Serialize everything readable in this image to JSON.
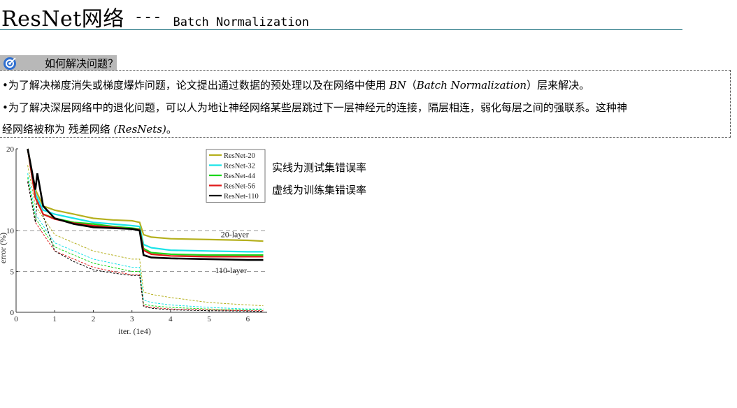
{
  "header": {
    "title": "ResNet网络",
    "dashes": "---",
    "subtitle": "Batch Normalization"
  },
  "question": {
    "icon": "target-icon",
    "text": "如何解决问题？"
  },
  "bullets": [
    {
      "prefix": "•为了解决梯度消失或梯度爆炸问题，论文提出通过数据的预处理以及在网络中使用 ",
      "term": "BN",
      "mid": "（",
      "term2": "Batch Normalization",
      "suffix": "）层来解决。"
    },
    {
      "text1": "•为了解决深层网络中的退化问题，可以人为地让神经网络某些层跳过下一层神经元的连接，隔层相连，弱化每层之间的强联系。这种神",
      "text2a": "经网络被称为 残差网络 ",
      "term": "(ResNets)",
      "text2b": "。"
    }
  ],
  "notes": [
    "实线为测试集错误率",
    "虚线为训练集错误率"
  ],
  "colors": {
    "accent_rule": "#2f7d89",
    "question_bar": "#b8b8b8"
  },
  "chart_data": {
    "type": "line",
    "xlabel": "iter. (1e4)",
    "ylabel": "error (%)",
    "xlim": [
      0,
      6.5
    ],
    "ylim": [
      0,
      20
    ],
    "xticks": [
      "0",
      "1",
      "2",
      "3",
      "4",
      "5",
      "6"
    ],
    "yticks": [
      "0",
      "5",
      "10",
      "20"
    ],
    "annotations": [
      "20-layer",
      "110-layer"
    ],
    "legend_position": "top-right",
    "series": [
      {
        "name": "ResNet-20",
        "color": "#b5b01e",
        "test": [
          [
            0.3,
            20
          ],
          [
            0.5,
            15
          ],
          [
            0.7,
            13
          ],
          [
            1,
            12.5
          ],
          [
            1.5,
            12
          ],
          [
            2,
            11.5
          ],
          [
            2.5,
            11.3
          ],
          [
            3,
            11.2
          ],
          [
            3.2,
            11
          ],
          [
            3.3,
            9.5
          ],
          [
            3.5,
            9.2
          ],
          [
            4,
            9
          ],
          [
            5,
            8.9
          ],
          [
            6,
            8.8
          ],
          [
            6.4,
            8.7
          ]
        ],
        "train": [
          [
            0.3,
            18
          ],
          [
            0.5,
            13
          ],
          [
            1,
            9.5
          ],
          [
            1.5,
            8.5
          ],
          [
            2,
            7.5
          ],
          [
            2.5,
            7
          ],
          [
            3,
            6.5
          ],
          [
            3.2,
            6.5
          ],
          [
            3.3,
            2.5
          ],
          [
            3.5,
            2.2
          ],
          [
            4,
            1.8
          ],
          [
            5,
            1.2
          ],
          [
            6,
            0.9
          ],
          [
            6.4,
            0.8
          ]
        ]
      },
      {
        "name": "ResNet-32",
        "color": "#19e3e8",
        "test": [
          [
            0.3,
            20
          ],
          [
            0.5,
            14.5
          ],
          [
            0.7,
            12.5
          ],
          [
            1,
            12
          ],
          [
            1.5,
            11.5
          ],
          [
            2,
            11
          ],
          [
            2.5,
            10.8
          ],
          [
            3,
            10.6
          ],
          [
            3.2,
            10.5
          ],
          [
            3.3,
            8.3
          ],
          [
            3.5,
            7.9
          ],
          [
            4,
            7.6
          ],
          [
            5,
            7.5
          ],
          [
            6,
            7.4
          ],
          [
            6.4,
            7.4
          ]
        ],
        "train": [
          [
            0.3,
            17
          ],
          [
            0.5,
            12
          ],
          [
            1,
            8.5
          ],
          [
            1.5,
            7.5
          ],
          [
            2,
            6.5
          ],
          [
            2.5,
            6
          ],
          [
            3,
            5.5
          ],
          [
            3.2,
            5.5
          ],
          [
            3.3,
            1.5
          ],
          [
            3.5,
            1.2
          ],
          [
            4,
            0.9
          ],
          [
            5,
            0.6
          ],
          [
            6,
            0.4
          ],
          [
            6.4,
            0.4
          ]
        ]
      },
      {
        "name": "ResNet-44",
        "color": "#1ad61a",
        "test": [
          [
            0.3,
            20
          ],
          [
            0.5,
            14
          ],
          [
            0.7,
            12
          ],
          [
            1,
            11.5
          ],
          [
            1.5,
            11
          ],
          [
            2,
            10.8
          ],
          [
            2.5,
            10.5
          ],
          [
            3,
            10.3
          ],
          [
            3.2,
            10.2
          ],
          [
            3.3,
            7.8
          ],
          [
            3.5,
            7.3
          ],
          [
            4,
            7.1
          ],
          [
            5,
            7
          ],
          [
            6,
            7
          ],
          [
            6.4,
            7
          ]
        ],
        "train": [
          [
            0.3,
            16.5
          ],
          [
            0.5,
            11.5
          ],
          [
            1,
            8
          ],
          [
            1.5,
            7
          ],
          [
            2,
            6
          ],
          [
            2.5,
            5.5
          ],
          [
            3,
            5
          ],
          [
            3.2,
            5
          ],
          [
            3.3,
            1
          ],
          [
            3.5,
            0.8
          ],
          [
            4,
            0.6
          ],
          [
            5,
            0.4
          ],
          [
            6,
            0.3
          ],
          [
            6.4,
            0.3
          ]
        ]
      },
      {
        "name": "ResNet-56",
        "color": "#e01a1a",
        "test": [
          [
            0.3,
            20
          ],
          [
            0.5,
            14
          ],
          [
            0.7,
            12
          ],
          [
            1,
            11.4
          ],
          [
            1.5,
            10.9
          ],
          [
            2,
            10.6
          ],
          [
            2.5,
            10.4
          ],
          [
            3,
            10.2
          ],
          [
            3.2,
            10.1
          ],
          [
            3.3,
            7.6
          ],
          [
            3.5,
            7.1
          ],
          [
            4,
            6.9
          ],
          [
            5,
            6.8
          ],
          [
            6,
            6.8
          ],
          [
            6.4,
            6.8
          ]
        ],
        "train": [
          [
            0.3,
            16
          ],
          [
            0.5,
            11
          ],
          [
            1,
            7.5
          ],
          [
            1.5,
            6.5
          ],
          [
            2,
            5.5
          ],
          [
            2.5,
            5
          ],
          [
            3,
            4.6
          ],
          [
            3.2,
            4.6
          ],
          [
            3.3,
            0.8
          ],
          [
            3.5,
            0.6
          ],
          [
            4,
            0.4
          ],
          [
            5,
            0.3
          ],
          [
            6,
            0.2
          ],
          [
            6.4,
            0.2
          ]
        ]
      },
      {
        "name": "ResNet-110",
        "color": "#000000",
        "test": [
          [
            0.3,
            20
          ],
          [
            0.5,
            15
          ],
          [
            0.55,
            17
          ],
          [
            0.7,
            13
          ],
          [
            1,
            11.5
          ],
          [
            1.5,
            10.8
          ],
          [
            2,
            10.4
          ],
          [
            2.5,
            10.3
          ],
          [
            3,
            10.2
          ],
          [
            3.2,
            10
          ],
          [
            3.3,
            7
          ],
          [
            3.5,
            6.7
          ],
          [
            4,
            6.6
          ],
          [
            5,
            6.5
          ],
          [
            6,
            6.4
          ],
          [
            6.4,
            6.4
          ]
        ],
        "train": [
          [
            0.3,
            16
          ],
          [
            0.5,
            11
          ],
          [
            0.55,
            14
          ],
          [
            1,
            7.5
          ],
          [
            1.5,
            6.2
          ],
          [
            2,
            5.2
          ],
          [
            2.5,
            4.8
          ],
          [
            3,
            4.5
          ],
          [
            3.2,
            4.5
          ],
          [
            3.3,
            0.7
          ],
          [
            3.5,
            0.5
          ],
          [
            4,
            0.3
          ],
          [
            5,
            0.2
          ],
          [
            6,
            0.15
          ],
          [
            6.4,
            0.1
          ]
        ]
      }
    ]
  }
}
